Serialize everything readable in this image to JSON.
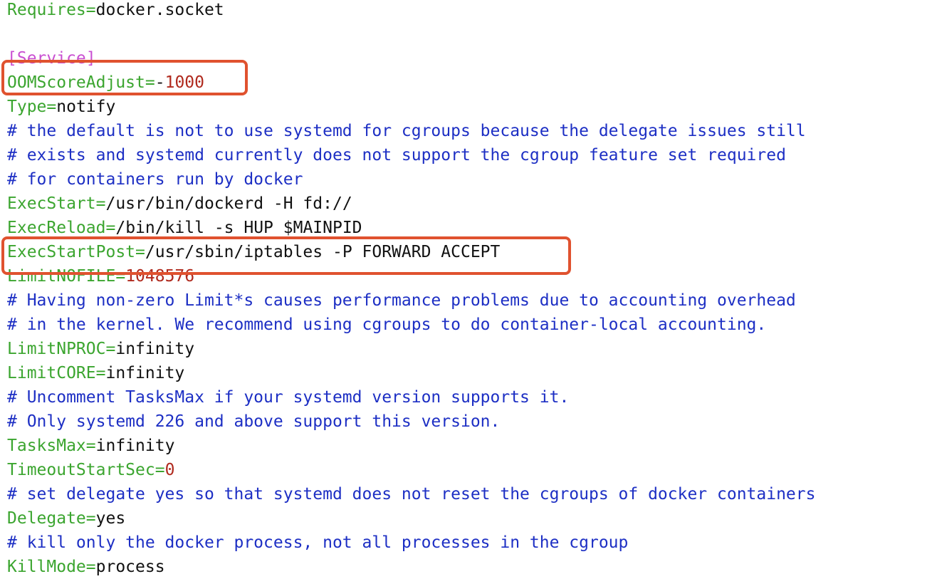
{
  "lines": [
    {
      "type": "kv",
      "key": "Requires",
      "value": "docker.socket"
    },
    {
      "type": "blank"
    },
    {
      "type": "section",
      "text": "[Service]"
    },
    {
      "type": "kv",
      "key": "OOMScoreAdjust",
      "value": "-1000",
      "value_kind": "number"
    },
    {
      "type": "kv",
      "key": "Type",
      "value": "notify"
    },
    {
      "type": "comment",
      "text": "# the default is not to use systemd for cgroups because the delegate issues still"
    },
    {
      "type": "comment",
      "text": "# exists and systemd currently does not support the cgroup feature set required"
    },
    {
      "type": "comment",
      "text": "# for containers run by docker"
    },
    {
      "type": "kv",
      "key": "ExecStart",
      "value": "/usr/bin/dockerd -H fd://"
    },
    {
      "type": "kv",
      "key": "ExecReload",
      "value": "/bin/kill -s HUP $MAINPID"
    },
    {
      "type": "kv",
      "key": "ExecStartPost",
      "value": "/usr/sbin/iptables -P FORWARD ACCEPT"
    },
    {
      "type": "kv",
      "key": "LimitNOFILE",
      "value": "1048576",
      "value_kind": "number"
    },
    {
      "type": "comment",
      "text": "# Having non-zero Limit*s causes performance problems due to accounting overhead"
    },
    {
      "type": "comment",
      "text": "# in the kernel. We recommend using cgroups to do container-local accounting."
    },
    {
      "type": "kv",
      "key": "LimitNPROC",
      "value": "infinity"
    },
    {
      "type": "kv",
      "key": "LimitCORE",
      "value": "infinity"
    },
    {
      "type": "comment",
      "text": "# Uncomment TasksMax if your systemd version supports it."
    },
    {
      "type": "comment",
      "text": "# Only systemd 226 and above support this version."
    },
    {
      "type": "kv",
      "key": "TasksMax",
      "value": "infinity"
    },
    {
      "type": "kv",
      "key": "TimeoutStartSec",
      "value": "0",
      "value_kind": "number"
    },
    {
      "type": "comment",
      "text": "# set delegate yes so that systemd does not reset the cgroups of docker containers"
    },
    {
      "type": "kv",
      "key": "Delegate",
      "value": "yes"
    },
    {
      "type": "comment",
      "text": "# kill only the docker process, not all processes in the cgroup"
    },
    {
      "type": "kv",
      "key": "KillMode",
      "value": "process"
    }
  ],
  "highlight_color": "#e0522f",
  "colors": {
    "key": "#3ba52f",
    "comment": "#1d2fc4",
    "number": "#b02a1e",
    "section": "#c94fd1",
    "text": "#111111"
  }
}
